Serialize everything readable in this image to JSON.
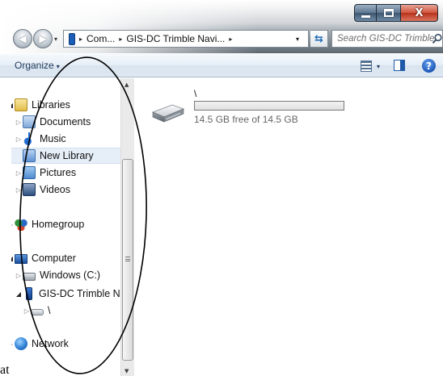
{
  "window": {
    "minimize_glyph": "",
    "maximize_glyph": "",
    "close_glyph": "X"
  },
  "navigation": {
    "back_icon": "arrow-left-icon",
    "forward_icon": "arrow-right-icon",
    "address": {
      "segments": [
        "Com...",
        "GIS-DC Trimble Navi..."
      ],
      "separator": "▸",
      "dropdown": "▾"
    },
    "refresh_glyph": "⇆",
    "search": {
      "placeholder": "Search GIS-DC Trimble N..."
    }
  },
  "command_bar": {
    "organize_label": "Organize",
    "organize_arrow": "▾",
    "views_arrow": "▾",
    "help_label": "?"
  },
  "tree": {
    "arrow_closed": "▷",
    "arrow_open": "◢",
    "items": [
      {
        "label": "Libraries",
        "icon": "library-icon",
        "expanded": true
      },
      {
        "label": "Documents",
        "icon": "documents-icon"
      },
      {
        "label": "Music",
        "icon": "music-icon"
      },
      {
        "label": "New Library",
        "icon": "new-library-icon",
        "selected": true
      },
      {
        "label": "Pictures",
        "icon": "pictures-icon"
      },
      {
        "label": "Videos",
        "icon": "videos-icon"
      },
      {
        "label": "Homegroup",
        "icon": "homegroup-icon"
      },
      {
        "label": "Computer",
        "icon": "computer-icon",
        "expanded": true
      },
      {
        "label": "Windows (C:)",
        "icon": "drive-icon"
      },
      {
        "label": "GIS-DC Trimble N",
        "icon": "device-icon",
        "expanded": true
      },
      {
        "label": "\\",
        "icon": "storage-icon"
      },
      {
        "label": "Network",
        "icon": "network-icon"
      }
    ]
  },
  "content": {
    "drive": {
      "name": "\\",
      "free_text": "14.5 GB free of 14.5 GB",
      "used_fraction": 0.0
    }
  },
  "page_fragment": {
    "text": "at"
  },
  "colors": {
    "accent": "#1d6ab5",
    "selection": "#e6eef8",
    "close_button": "#c8472f"
  }
}
